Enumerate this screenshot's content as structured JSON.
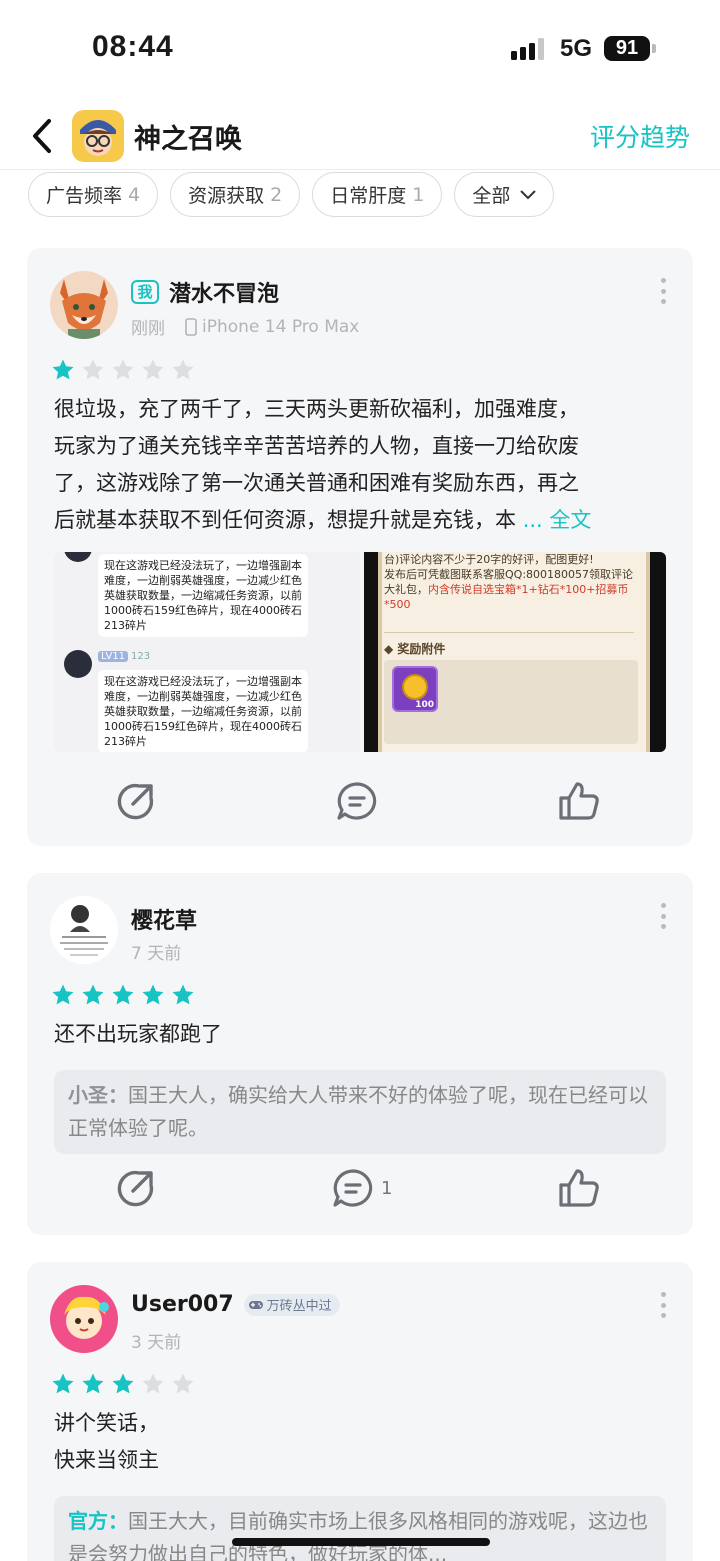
{
  "status_bar": {
    "time": "08:44",
    "network": "5G",
    "battery": "91"
  },
  "header": {
    "title": "神之召唤",
    "trend_link": "评分趋势"
  },
  "tags": [
    {
      "label": "广告频率",
      "count": "4"
    },
    {
      "label": "资源获取",
      "count": "2"
    },
    {
      "label": "日常肝度",
      "count": "1"
    }
  ],
  "filter": {
    "label": "全部"
  },
  "reviews": [
    {
      "me_badge": "我",
      "user": "潜水不冒泡",
      "time": "刚刚",
      "device": "iPhone 14 Pro Max",
      "rating": 1,
      "text_lines": [
        "很垃圾，充了两千了，三天两头更新砍福利，加强难度，",
        "玩家为了通关充钱辛辛苦苦培养的人物，直接一刀给砍废",
        "了，这游戏除了第一次通关普通和困难有奖励东西，再之",
        "后就基本获取不到任何资源，想提升就是充钱，本"
      ],
      "full_text_link": "... 全文",
      "shot_a": {
        "bubble_1": "现在这游戏已经没法玩了，一边增强副本难度，一边削弱英雄强度，一边减少红色英雄获取数量，一边缩减任务资源，以前1000砖石159红色碎片，现在4000砖石213碎片",
        "lv_tag": "LV11",
        "lv_num": "123",
        "bubble_2": "现在这游戏已经没法玩了，一边增强副本难度，一边削弱英雄强度，一边减少红色英雄获取数量，一边缩减任务资源，以前1000砖石159红色碎片，现在4000砖石213碎片"
      },
      "shot_b": {
        "line_1": "台)评论内容不少于20字的好评，配图更好!",
        "line_2": "发布后可凭截图联系客服QQ:800180057领取评论",
        "line_3": "大礼包，",
        "line_3_red": "内含传说自选宝箱*1+钻石*100+招募币",
        "line_4_red": "*500",
        "attach_title": "奖励附件",
        "coin_count": "100"
      }
    },
    {
      "user": "樱花草",
      "time": "7 天前",
      "rating": 5,
      "text_lines": [
        "还不出玩家都跑了"
      ],
      "reply_who": "小圣：",
      "reply_text": "国王大人，确实给大人带来不好的体验了呢，现在已经可以正常体验了呢。",
      "comment_count": "1"
    },
    {
      "user": "User007",
      "play_badge": "万砖丛中过",
      "time": "3 天前",
      "rating": 3,
      "text_lines": [
        "讲个笑话，",
        "快来当领主"
      ],
      "reply_who": "官方：",
      "reply_text": "国王大大，目前确实市场上很多风格相同的游戏呢，这边也是会努力做出自己的特色，做好玩家的体..."
    }
  ],
  "colors": {
    "accent": "#17c3c3",
    "card_bg": "#f5f6f8",
    "star_off": "#dcdee2"
  }
}
